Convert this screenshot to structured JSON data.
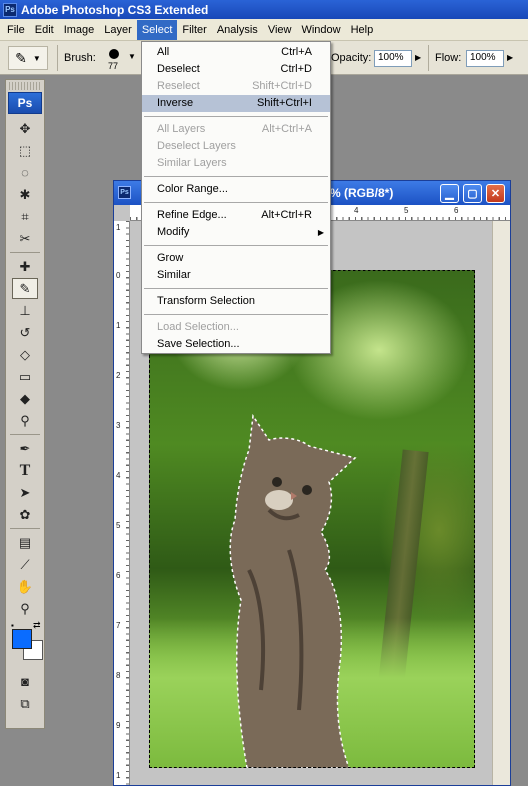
{
  "app": {
    "title": "Adobe Photoshop CS3 Extended",
    "logo": "Ps"
  },
  "menubar": [
    "File",
    "Edit",
    "Image",
    "Layer",
    "Select",
    "Filter",
    "Analysis",
    "View",
    "Window",
    "Help"
  ],
  "optionsbar": {
    "brush_label": "Brush:",
    "brush_size": "77",
    "opacity_label": "Opacity:",
    "opacity_value": "100%",
    "flow_label": "Flow:",
    "flow_value": "100%"
  },
  "select_menu": {
    "items": [
      {
        "label": "All",
        "shortcut": "Ctrl+A",
        "enabled": true
      },
      {
        "label": "Deselect",
        "shortcut": "Ctrl+D",
        "enabled": true
      },
      {
        "label": "Reselect",
        "shortcut": "Shift+Ctrl+D",
        "enabled": false
      },
      {
        "label": "Inverse",
        "shortcut": "Shift+Ctrl+I",
        "enabled": true,
        "highlighted": true
      },
      {
        "label": "All Layers",
        "shortcut": "Alt+Ctrl+A",
        "enabled": false
      },
      {
        "label": "Deselect Layers",
        "shortcut": "",
        "enabled": false
      },
      {
        "label": "Similar Layers",
        "shortcut": "",
        "enabled": false
      },
      {
        "label": "Color Range...",
        "shortcut": "",
        "enabled": true
      },
      {
        "label": "Refine Edge...",
        "shortcut": "Alt+Ctrl+R",
        "enabled": true
      },
      {
        "label": "Modify",
        "shortcut": "",
        "enabled": true,
        "submenu": true
      },
      {
        "label": "Grow",
        "shortcut": "",
        "enabled": true
      },
      {
        "label": "Similar",
        "shortcut": "",
        "enabled": true
      },
      {
        "label": "Transform Selection",
        "shortcut": "",
        "enabled": true
      },
      {
        "label": "Load Selection...",
        "shortcut": "",
        "enabled": false
      },
      {
        "label": "Save Selection...",
        "shortcut": "",
        "enabled": true
      }
    ]
  },
  "toolbox": {
    "badge": "Ps",
    "tools": [
      "move-tool",
      "marquee-tool",
      "lasso-tool",
      "magic-wand-tool",
      "crop-tool",
      "slice-tool",
      "healing-brush-tool",
      "brush-tool",
      "clone-stamp-tool",
      "history-brush-tool",
      "eraser-tool",
      "gradient-tool",
      "blur-tool",
      "dodge-tool",
      "pen-tool",
      "type-tool",
      "path-selection-tool",
      "shape-tool",
      "notes-tool",
      "eyedropper-tool",
      "hand-tool",
      "zoom-tool"
    ],
    "selected_tool": "brush-tool",
    "foreground_color": "#0a6cff",
    "background_color": "#ffffff"
  },
  "document": {
    "title_fragment": "% (RGB/8*)",
    "hruler_numbers": [
      "4",
      "5",
      "6"
    ],
    "vruler_numbers": [
      "1",
      "0",
      "1",
      "2",
      "3",
      "4",
      "5",
      "6",
      "7",
      "8",
      "9",
      "1"
    ]
  }
}
